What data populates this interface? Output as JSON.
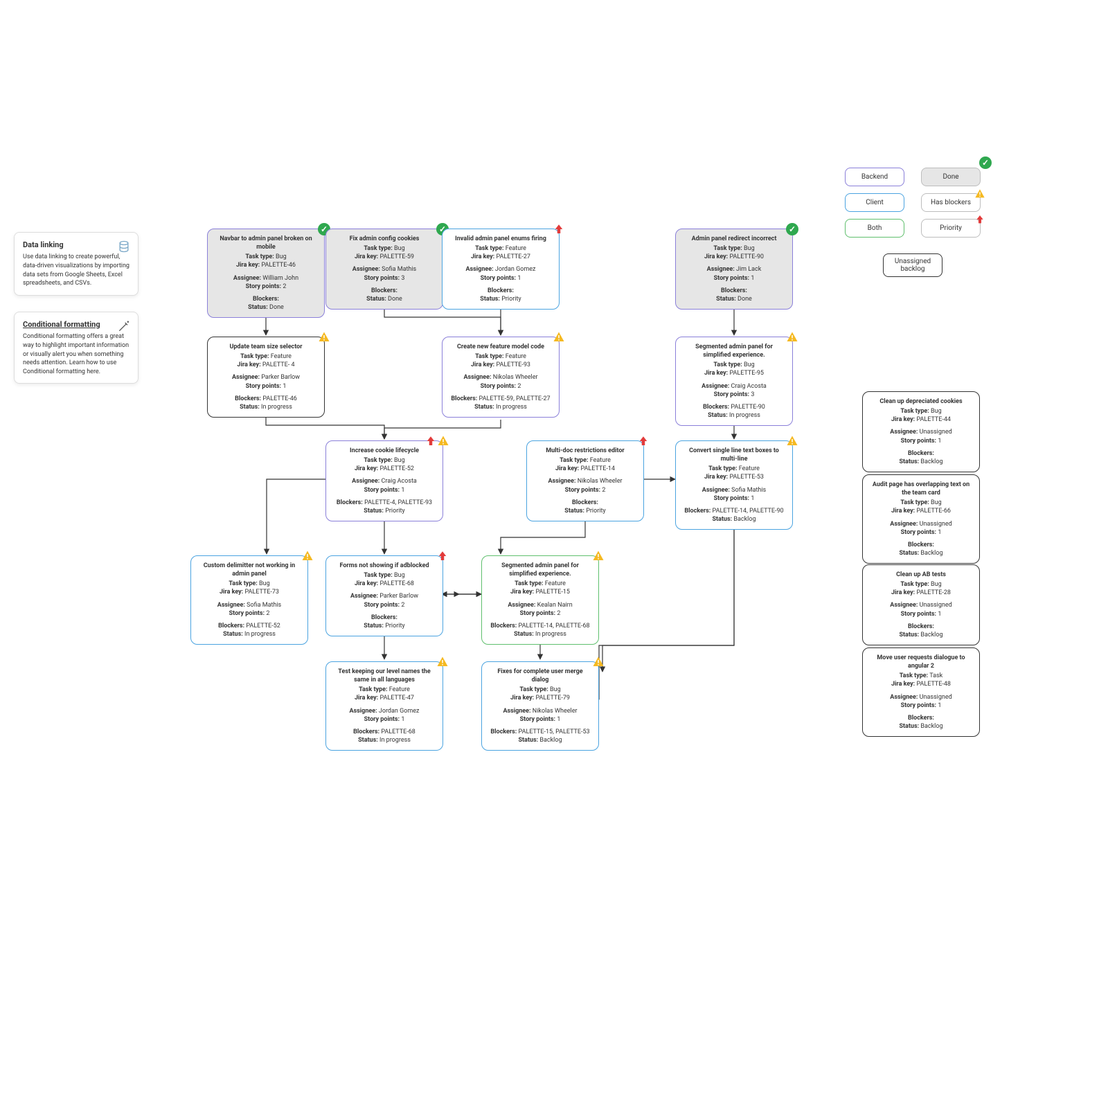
{
  "info": {
    "data_linking": {
      "title": "Data linking",
      "body": "Use data linking to create powerful, data-driven visualizations by importing data sets from Google Sheets, Excel spreadsheets, and CSVs."
    },
    "conditional": {
      "title": "Conditional formatting",
      "body": "Conditional formatting offers a great way to highlight important information or visually alert you when something needs attention. Learn how to use Conditional formatting here."
    }
  },
  "legend": {
    "backend": "Backend",
    "client": "Client",
    "both": "Both",
    "done": "Done",
    "has_blockers": "Has blockers",
    "priority": "Priority",
    "unassigned": "Unassigned backlog"
  },
  "labels": {
    "task_type": "Task type:",
    "jira_key": "Jira key:",
    "assignee": "Assignee:",
    "story_points": "Story points:",
    "blockers": "Blockers:",
    "status": "Status:"
  },
  "cards": {
    "p46": {
      "title": "Navbar to admin panel broken on mobile",
      "type": "Bug",
      "key": "PALETTE-46",
      "assignee": "William John",
      "points": "2",
      "blockers": "",
      "status": "Done"
    },
    "p59": {
      "title": "Fix admin config cookies",
      "type": "Bug",
      "key": "PALETTE-59",
      "assignee": "Sofia Mathis",
      "points": "3",
      "blockers": "",
      "status": "Done"
    },
    "p27": {
      "title": "Invalid admin panel enums firing",
      "type": "Feature",
      "key": "PALETTE-27",
      "assignee": "Jordan Gomez",
      "points": "1",
      "blockers": "",
      "status": "Priority"
    },
    "p90": {
      "title": "Admin panel redirect incorrect",
      "type": "Bug",
      "key": "PALETTE-90",
      "assignee": "Jim Lack",
      "points": "1",
      "blockers": "",
      "status": "Done"
    },
    "p4": {
      "title": "Update team size selector",
      "type": "Feature",
      "key": "PALETTE- 4",
      "assignee": "Parker Barlow",
      "points": "1",
      "blockers": "PALETTE-46",
      "status": "In progress"
    },
    "p93": {
      "title": "Create new feature model code",
      "type": "Feature",
      "key": "PALETTE-93",
      "assignee": "Nikolas Wheeler",
      "points": "2",
      "blockers": "PALETTE-59, PALETTE-27",
      "status": "In progress"
    },
    "p95": {
      "title": "Segmented admin panel for simplified experience.",
      "type": "Bug",
      "key": "PALETTE-95",
      "assignee": "Craig Acosta",
      "points": "3",
      "blockers": "PALETTE-90",
      "status": "In progress"
    },
    "p52": {
      "title": "Increase cookie lifecycle",
      "type": "Bug",
      "key": "PALETTE-52",
      "assignee": "Craig Acosta",
      "points": "1",
      "blockers": "PALETTE-4, PALETTE-93",
      "status": "Priority"
    },
    "p14": {
      "title": "Multi-doc restrictions editor",
      "type": "Feature",
      "key": "PALETTE-14",
      "assignee": "Nikolas Wheeler",
      "points": "2",
      "blockers": "",
      "status": "Priority"
    },
    "p53": {
      "title": "Convert single line text boxes to multi-line",
      "type": "Feature",
      "key": "PALETTE-53",
      "assignee": "Sofia Mathis",
      "points": "1",
      "blockers": "PALETTE-14, PALETTE-90",
      "status": "Backlog"
    },
    "p73": {
      "title": "Custom delimitter not working in admin panel",
      "type": "Bug",
      "key": "PALETTE-73",
      "assignee": "Sofia Mathis",
      "points": "2",
      "blockers": "PALETTE-52",
      "status": "In progress"
    },
    "p68": {
      "title": "Forms not showing if adblocked",
      "type": "Bug",
      "key": "PALETTE-68",
      "assignee": "Parker Barlow",
      "points": "2",
      "blockers": "",
      "status": "Priority"
    },
    "p15": {
      "title": "Segmented admin panel for simplified experience.",
      "type": "Feature",
      "key": "PALETTE-15",
      "assignee": "Kealan Nairn",
      "points": "2",
      "blockers": "PALETTE-14, PALETTE-68",
      "status": "In progress"
    },
    "p47": {
      "title": "Test keeping our level names the same in all languages",
      "type": "Feature",
      "key": "PALETTE-47",
      "assignee": "Jordan Gomez",
      "points": "1",
      "blockers": "PALETTE-68",
      "status": "In progress"
    },
    "p79": {
      "title": "Fixes for complete user merge dialog",
      "type": "Bug",
      "key": "PALETTE-79",
      "assignee": "Nikolas Wheeler",
      "points": "1",
      "blockers": "PALETTE-15, PALETTE-53",
      "status": "Backlog"
    },
    "p44": {
      "title": "Clean up depreciated cookies",
      "type": "Bug",
      "key": "PALETTE-44",
      "assignee": "Unassigned",
      "points": "1",
      "blockers": "",
      "status": "Backlog"
    },
    "p66": {
      "title": "Audit page has overlapping text on the team card",
      "type": "Bug",
      "key": "PALETTE-66",
      "assignee": "Unassigned",
      "points": "1",
      "blockers": "",
      "status": "Backlog"
    },
    "p28": {
      "title": "Clean up AB tests",
      "type": "Bug",
      "key": "PALETTE-28",
      "assignee": "Unassigned",
      "points": "1",
      "blockers": "",
      "status": "Backlog"
    },
    "p48": {
      "title": "Move user requests dialogue to angular 2",
      "type": "Task",
      "key": "PALETTE-48",
      "assignee": "Unassigned",
      "points": "1",
      "blockers": "",
      "status": "Backlog"
    }
  }
}
